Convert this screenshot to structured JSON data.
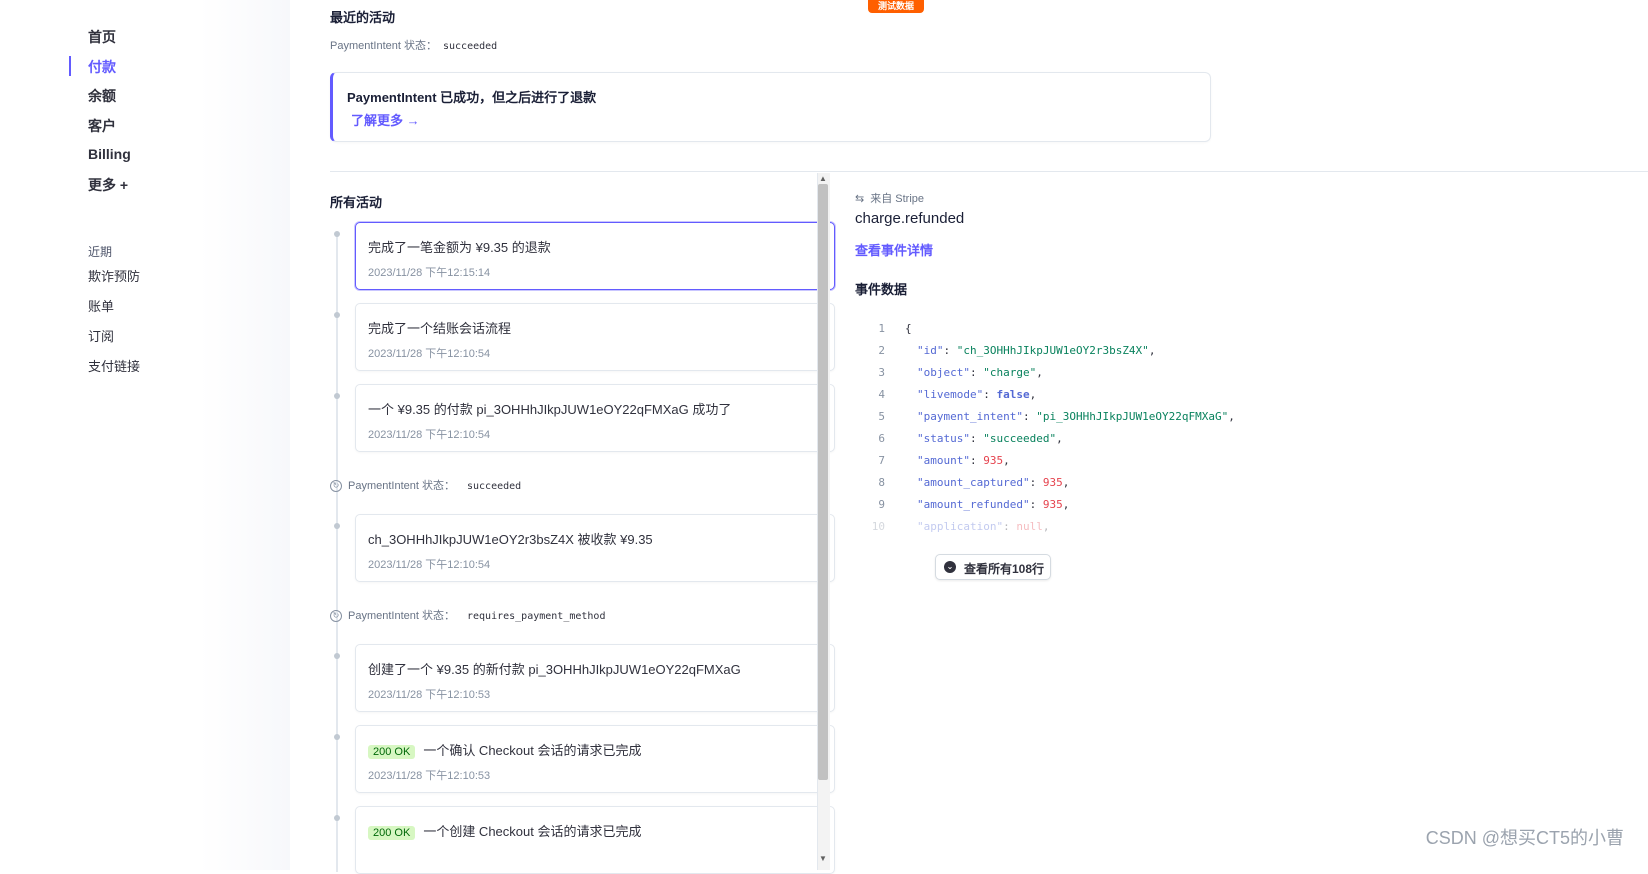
{
  "test_badge": "测试数据",
  "sidebar": {
    "primary": [
      {
        "label": "首页",
        "active": false
      },
      {
        "label": "付款",
        "active": true
      },
      {
        "label": "余额",
        "active": false
      },
      {
        "label": "客户",
        "active": false
      },
      {
        "label": "Billing",
        "active": false
      },
      {
        "label": "更多 +",
        "active": false
      }
    ],
    "recent_heading": "近期",
    "recent_items": [
      "欺诈预防",
      "账单",
      "订阅",
      "支付链接"
    ]
  },
  "recent": {
    "title": "最近的活动",
    "status_label": "PaymentIntent 状态：",
    "status_value": "succeeded",
    "callout_title": "PaymentIntent 已成功，但之后进行了退款",
    "callout_link": "了解更多 →"
  },
  "all_activity": {
    "title": "所有活动",
    "cards": [
      {
        "text": "完成了一笔金额为 ¥9.35 的退款",
        "date": "2023/11/28 下午12:15:14",
        "badge": ""
      },
      {
        "text": "完成了一个结账会话流程",
        "date": "2023/11/28 下午12:10:54",
        "badge": ""
      },
      {
        "text": "一个 ¥9.35 的付款 pi_3OHHhJIkpJUW1eOY22qFMXaG 成功了",
        "date": "2023/11/28 下午12:10:54",
        "badge": ""
      },
      {
        "text": "ch_3OHHhJIkpJUW1eOY2r3bsZ4X 被收款 ¥9.35",
        "date": "2023/11/28 下午12:10:54",
        "badge": ""
      },
      {
        "text": "创建了一个 ¥9.35 的新付款 pi_3OHHhJIkpJUW1eOY22qFMXaG",
        "date": "2023/11/28 下午12:10:53",
        "badge": ""
      },
      {
        "text": "一个确认 Checkout 会话的请求已完成",
        "date": "2023/11/28 下午12:10:53",
        "badge": "200 OK"
      },
      {
        "text": "一个创建 Checkout 会话的请求已完成",
        "date": "",
        "badge": "200 OK"
      }
    ],
    "states": [
      {
        "label": "PaymentIntent 状态：",
        "value": "succeeded"
      },
      {
        "label": "PaymentIntent 状态：",
        "value": "requires_payment_method"
      }
    ]
  },
  "event": {
    "source": "来自 Stripe",
    "type": "charge.refunded",
    "details_link": "查看事件详情",
    "data_title": "事件数据",
    "view_all": "查看所有108行",
    "code_lines": [
      {
        "n": "1",
        "key": "",
        "val": "{",
        "kind": "p",
        "comma": false
      },
      {
        "n": "2",
        "key": "\"id\"",
        "val": "\"ch_3OHHhJIkpJUW1eOY2r3bsZ4X\"",
        "kind": "s",
        "comma": true
      },
      {
        "n": "3",
        "key": "\"object\"",
        "val": "\"charge\"",
        "kind": "s",
        "comma": true
      },
      {
        "n": "4",
        "key": "\"livemode\"",
        "val": "false",
        "kind": "b",
        "comma": true
      },
      {
        "n": "5",
        "key": "\"payment_intent\"",
        "val": "\"pi_3OHHhJIkpJUW1eOY22qFMXaG\"",
        "kind": "s",
        "comma": true
      },
      {
        "n": "6",
        "key": "\"status\"",
        "val": "\"succeeded\"",
        "kind": "s",
        "comma": true
      },
      {
        "n": "7",
        "key": "\"amount\"",
        "val": "935",
        "kind": "n",
        "comma": true
      },
      {
        "n": "8",
        "key": "\"amount_captured\"",
        "val": "935",
        "kind": "n",
        "comma": true
      },
      {
        "n": "9",
        "key": "\"amount_refunded\"",
        "val": "935",
        "kind": "n",
        "comma": true
      },
      {
        "n": "10",
        "key": "\"application\"",
        "val": "null",
        "kind": "n",
        "comma": true
      }
    ]
  },
  "watermark": "CSDN @想买CT5的小曹"
}
